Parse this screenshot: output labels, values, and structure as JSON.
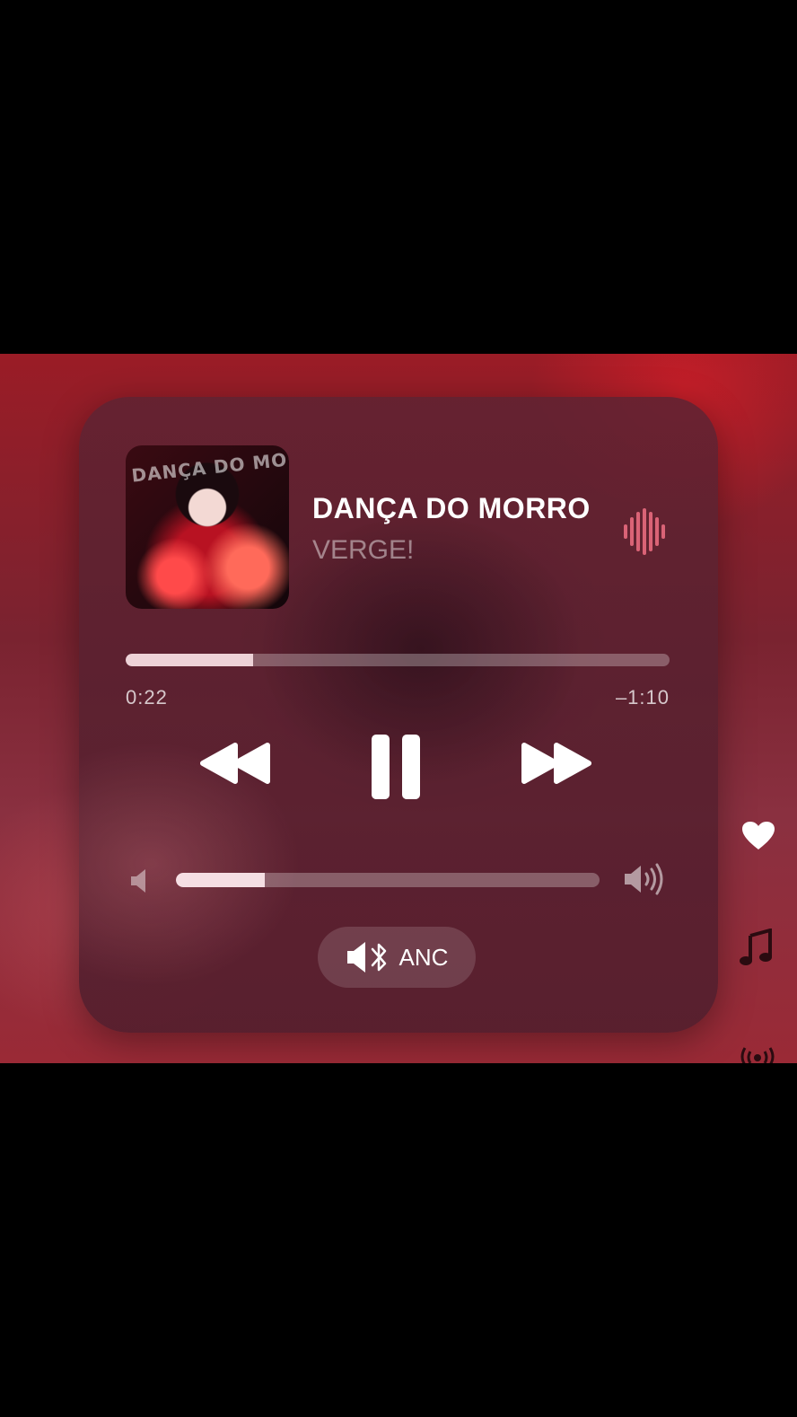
{
  "now_playing": {
    "title": "DANÇA DO MORRO",
    "artist": "VERGE!",
    "artwork_text": "DANÇA DO MORRO",
    "elapsed": "0:22",
    "remaining": "–1:10",
    "progress_fraction": 0.234
  },
  "volume": {
    "level_fraction": 0.21
  },
  "output": {
    "label": "ANC"
  },
  "icons": {
    "waveform": "waveform-icon",
    "rewind": "rewind-icon",
    "pause": "pause-icon",
    "forward": "fast-forward-icon",
    "volume_low": "speaker-low-icon",
    "volume_high": "speaker-high-icon",
    "bluetooth_speaker": "bluetooth-speaker-icon",
    "heart": "heart-icon",
    "music_note": "music-note-icon",
    "broadcast": "broadcast-icon"
  },
  "colors": {
    "background": "#000000",
    "accent_red": "#9a1c26",
    "card": "#5f2332",
    "text_primary": "#ffffff"
  }
}
